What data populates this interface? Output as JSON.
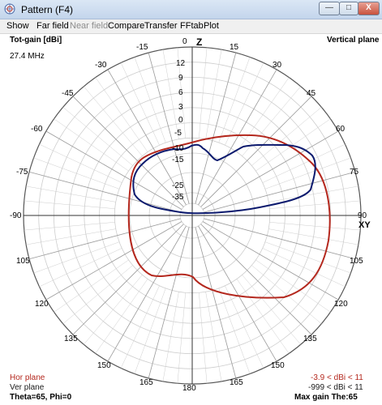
{
  "window": {
    "title": "Pattern   (F4)",
    "min_glyph": "—",
    "max_glyph": "□",
    "close_glyph": "X"
  },
  "menu": [
    "Show",
    "Far field",
    "Near field",
    "Compare",
    "Transfer",
    "FFtab",
    "Plot"
  ],
  "plot": {
    "quantity": "Tot-gain [dBi]",
    "frequency": "27.4 MHz",
    "plane": "Vertical plane",
    "axis_top": "Z",
    "axis_right": "XY",
    "angle_labels": [
      "0",
      "15",
      "30",
      "45",
      "60",
      "75",
      "90",
      "105",
      "120",
      "135",
      "150",
      "165",
      "180",
      "165",
      "150",
      "135",
      "120",
      "105",
      "-90",
      "-75",
      "-60",
      "-45",
      "-30",
      "-15"
    ],
    "gain_labels": [
      "12",
      "9",
      "6",
      "3",
      "0",
      "-5",
      "-10",
      "-15",
      "-25",
      "-35"
    ],
    "legend": {
      "hor_plane": "Hor plane",
      "ver_plane": "Ver plane",
      "hor_range": "-3.9 < dBi < 11",
      "ver_range": "-999 < dBi < 11",
      "cursor": "Theta=65, Phi=0",
      "max_gain": "Max gain The:65"
    }
  },
  "colors": {
    "hor_plane": "#b4281e",
    "ver_plane": "#0c1a6e",
    "grid": "#cdcdcd",
    "grid_major": "#9a9a9a"
  },
  "chart_data": {
    "type": "polar",
    "units": "dBi",
    "rings": [
      12,
      9,
      6,
      3,
      0,
      -5,
      -10,
      -15,
      -25,
      -35
    ],
    "angle_step_deg": 15,
    "series": [
      {
        "name": "Hor plane",
        "color": "#b4281e",
        "range": "-3.9 < dBi < 11"
      },
      {
        "name": "Ver plane",
        "color": "#0c1a6e",
        "range": "-999 < dBi < 11"
      }
    ]
  }
}
